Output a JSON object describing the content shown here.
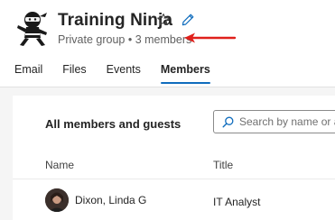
{
  "group": {
    "name": "Training Ninja",
    "visibility": "Private group",
    "separator": "•",
    "member_count_label": "3 members"
  },
  "icons": {
    "logo": "ninja-logo-icon",
    "favorite": "star-icon",
    "edit": "pencil-icon",
    "search": "search-icon",
    "annotation": "red-arrow-icon"
  },
  "tabs": [
    {
      "label": "Email",
      "active": false
    },
    {
      "label": "Files",
      "active": false
    },
    {
      "label": "Events",
      "active": false
    },
    {
      "label": "Members",
      "active": true
    }
  ],
  "members_panel": {
    "title": "All members and guests",
    "search": {
      "placeholder": "Search by name or al",
      "value": ""
    },
    "columns": {
      "name": "Name",
      "title": "Title"
    },
    "rows": [
      {
        "name": "Dixon, Linda G",
        "title": "IT Analyst"
      }
    ]
  },
  "colors": {
    "accent": "#0f6cbd",
    "annotation_arrow": "#e0201b",
    "page_background": "#f5f5f5"
  }
}
